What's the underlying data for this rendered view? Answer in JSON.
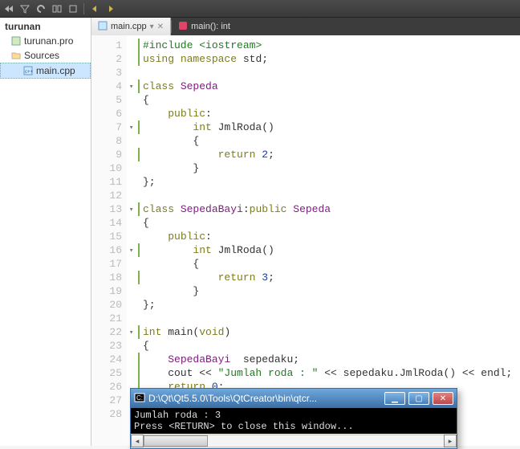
{
  "toolbar": {},
  "sidebar": {
    "root": "turunan",
    "items": [
      {
        "label": "turunan.pro"
      },
      {
        "label": "Sources"
      },
      {
        "label": "main.cpp"
      }
    ]
  },
  "tabs": {
    "file": "main.cpp",
    "symbol": "main(): int"
  },
  "code": {
    "lines": [
      {
        "n": 1,
        "g": 1,
        "f": 0,
        "html": "<span class='pre'>#include</span> <span class='pre'>&lt;iostream&gt;</span>"
      },
      {
        "n": 2,
        "g": 1,
        "f": 0,
        "html": "<span class='kw'>using</span> <span class='kw'>namespace</span> std;"
      },
      {
        "n": 3,
        "g": 0,
        "f": 0,
        "html": ""
      },
      {
        "n": 4,
        "g": 1,
        "f": 1,
        "html": "<span class='kw'>class</span> <span class='typ'>Sepeda</span>"
      },
      {
        "n": 5,
        "g": 0,
        "f": 0,
        "html": "{"
      },
      {
        "n": 6,
        "g": 0,
        "f": 0,
        "html": "    <span class='kw'>public</span>:"
      },
      {
        "n": 7,
        "g": 1,
        "f": 1,
        "html": "        <span class='kw'>int</span> JmlRoda()"
      },
      {
        "n": 8,
        "g": 0,
        "f": 0,
        "html": "        {"
      },
      {
        "n": 9,
        "g": 1,
        "f": 0,
        "html": "            <span class='kw'>return</span> <span class='num'>2</span>;"
      },
      {
        "n": 10,
        "g": 0,
        "f": 0,
        "html": "        }"
      },
      {
        "n": 11,
        "g": 0,
        "f": 0,
        "html": "};"
      },
      {
        "n": 12,
        "g": 0,
        "f": 0,
        "html": ""
      },
      {
        "n": 13,
        "g": 1,
        "f": 1,
        "html": "<span class='kw'>class</span> <span class='typ'>SepedaBayi</span>:<span class='kw'>public</span> <span class='typ'>Sepeda</span>"
      },
      {
        "n": 14,
        "g": 0,
        "f": 0,
        "html": "{"
      },
      {
        "n": 15,
        "g": 0,
        "f": 0,
        "html": "    <span class='kw'>public</span>:"
      },
      {
        "n": 16,
        "g": 1,
        "f": 1,
        "html": "        <span class='kw'>int</span> JmlRoda()"
      },
      {
        "n": 17,
        "g": 0,
        "f": 0,
        "html": "        {"
      },
      {
        "n": 18,
        "g": 1,
        "f": 0,
        "html": "            <span class='kw'>return</span> <span class='num'>3</span>;"
      },
      {
        "n": 19,
        "g": 0,
        "f": 0,
        "html": "        }"
      },
      {
        "n": 20,
        "g": 0,
        "f": 0,
        "html": "};"
      },
      {
        "n": 21,
        "g": 0,
        "f": 0,
        "html": ""
      },
      {
        "n": 22,
        "g": 1,
        "f": 1,
        "html": "<span class='kw'>int</span> main(<span class='kw'>void</span>)"
      },
      {
        "n": 23,
        "g": 0,
        "f": 0,
        "html": "{"
      },
      {
        "n": 24,
        "g": 1,
        "f": 0,
        "html": "    <span class='typ'>SepedaBayi</span>  sepedaku;"
      },
      {
        "n": 25,
        "g": 1,
        "f": 0,
        "html": "    cout &lt;&lt; <span class='str'>\"Jumlah roda : \"</span> &lt;&lt; sepedaku.JmlRoda() &lt;&lt; endl;"
      },
      {
        "n": 26,
        "g": 1,
        "f": 0,
        "html": "    <span class='kw'>return</span> <span class='num'>0</span>;"
      },
      {
        "n": 27,
        "g": 0,
        "f": 0,
        "html": "}"
      },
      {
        "n": 28,
        "g": 1,
        "f": 0,
        "html": ""
      }
    ]
  },
  "console": {
    "title": "D:\\Qt\\Qt5.5.0\\Tools\\QtCreator\\bin\\qtcr...",
    "line1": "Jumlah roda : 3",
    "line2": "Press <RETURN> to close this window..."
  }
}
